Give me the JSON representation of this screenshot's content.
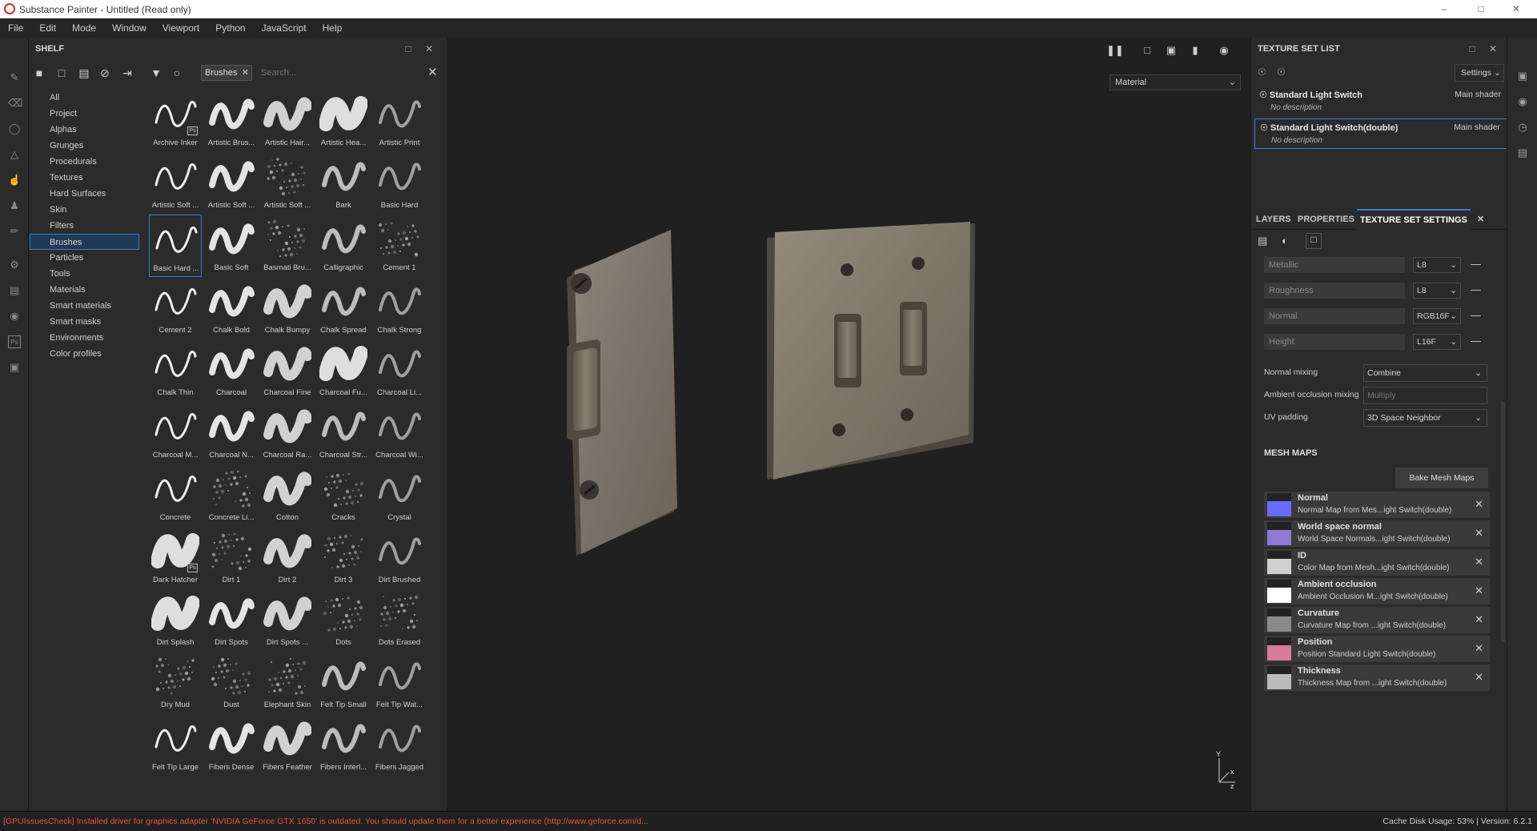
{
  "window": {
    "title": "Substance Painter - Untitled (Read only)"
  },
  "menu": [
    "File",
    "Edit",
    "Mode",
    "Window",
    "Viewport",
    "Python",
    "JavaScript",
    "Help"
  ],
  "shelf": {
    "title": "SHELF",
    "filter_tag": "Brushes",
    "search_placeholder": "Search...",
    "categories": [
      "All",
      "Project",
      "Alphas",
      "Grunges",
      "Procedurals",
      "Textures",
      "Hard Surfaces",
      "Skin",
      "Filters",
      "Brushes",
      "Particles",
      "Tools",
      "Materials",
      "Smart materials",
      "Smart masks",
      "Environments",
      "Color profiles"
    ],
    "selected_category": "Brushes",
    "brushes": [
      "Archive Inker",
      "Artistic Brus...",
      "Artistic Hair...",
      "Artistic Hea...",
      "Artistic Print",
      "Artistic Soft ...",
      "Artistic Soft ...",
      "Artistic Soft ...",
      "Bark",
      "Basic Hard",
      "Basic Hard ...",
      "Basic Soft",
      "Basmati Bru...",
      "Calligraphic",
      "Cement 1",
      "Cement 2",
      "Chalk Bold",
      "Chalk Bumpy",
      "Chalk Spread",
      "Chalk Strong",
      "Chalk Thin",
      "Charcoal",
      "Charcoal Fine",
      "Charcoal Fu...",
      "Charcoal Li...",
      "Charcoal M...",
      "Charcoal N...",
      "Charcoal Ra...",
      "Charcoal Str...",
      "Charcoal Wi...",
      "Concrete",
      "Concrete Li...",
      "Cotton",
      "Cracks",
      "Crystal",
      "Dark Hatcher",
      "Dirt 1",
      "Dirt 2",
      "Dirt 3",
      "Dirt Brushed",
      "Dirt Splash",
      "Dirt Spots",
      "Dirt Spots ...",
      "Dots",
      "Dots Erased",
      "Dry Mud",
      "Dust",
      "Elephant Skin",
      "Felt Tip Small",
      "Felt Tip Wat...",
      "Felt Tip Large",
      "Fibers Dense",
      "Fibers Feather",
      "Fibers Interl...",
      "Fibers Jagged"
    ],
    "selected_brush": "Basic Hard ...",
    "ps_badge": "Ps"
  },
  "viewport": {
    "material_mode": "Material",
    "axis_y": "Y",
    "axis_x": "x",
    "axis_z": "z"
  },
  "texture_set_list": {
    "title": "TEXTURE SET LIST",
    "settings_label": "Settings",
    "items": [
      {
        "name": "Standard Light Switch",
        "desc": "No description",
        "shader": "Main shader"
      },
      {
        "name": "Standard Light Switch(double)",
        "desc": "No description",
        "shader": "Main shader"
      }
    ]
  },
  "tabs": [
    "LAYERS",
    "PROPERTIES",
    "TEXTURE SET SETTINGS"
  ],
  "channels": [
    {
      "name": "Metallic",
      "format": "L8"
    },
    {
      "name": "Roughness",
      "format": "L8"
    },
    {
      "name": "Normal",
      "format": "RGB16F"
    },
    {
      "name": "Height",
      "format": "L16F"
    }
  ],
  "settings": {
    "normal_mixing_label": "Normal mixing",
    "normal_mixing_value": "Combine",
    "ao_mixing_label": "Ambient occlusion mixing",
    "ao_mixing_value": "Multiply",
    "uv_padding_label": "UV padding",
    "uv_padding_value": "3D Space Neighbor"
  },
  "mesh_maps": {
    "title": "MESH MAPS",
    "bake_label": "Bake Mesh Maps",
    "items": [
      {
        "name": "Normal",
        "desc": "Normal Map from Mes...ight Switch(double)"
      },
      {
        "name": "World space normal",
        "desc": "World Space Normals...ight Switch(double)"
      },
      {
        "name": "ID",
        "desc": "Color Map from Mesh...ight Switch(double)"
      },
      {
        "name": "Ambient occlusion",
        "desc": "Ambient Occlusion M...ight Switch(double)"
      },
      {
        "name": "Curvature",
        "desc": "Curvature Map from ...ight Switch(double)"
      },
      {
        "name": "Position",
        "desc": "Position Standard Light Switch(double)"
      },
      {
        "name": "Thickness",
        "desc": "Thickness Map from ...ight Switch(double)"
      }
    ],
    "thumb_colors": [
      "#6b6bff",
      "#8f7ad8",
      "#d0d0d0",
      "#ffffff",
      "#8a8a8a",
      "#d87a9a",
      "#bbbbbb"
    ]
  },
  "status": {
    "message": "[GPUIssuesCheck] Installed driver for graphics adapter 'NVIDIA GeForce GTX 1650' is outdated. You should update them for a better experience (http://www.geforce.com/d...",
    "cache": "Cache Disk Usage:    53% | Version: 6.2.1"
  },
  "colors": {
    "accent": "#3a7bd5",
    "error": "#e0553b"
  }
}
